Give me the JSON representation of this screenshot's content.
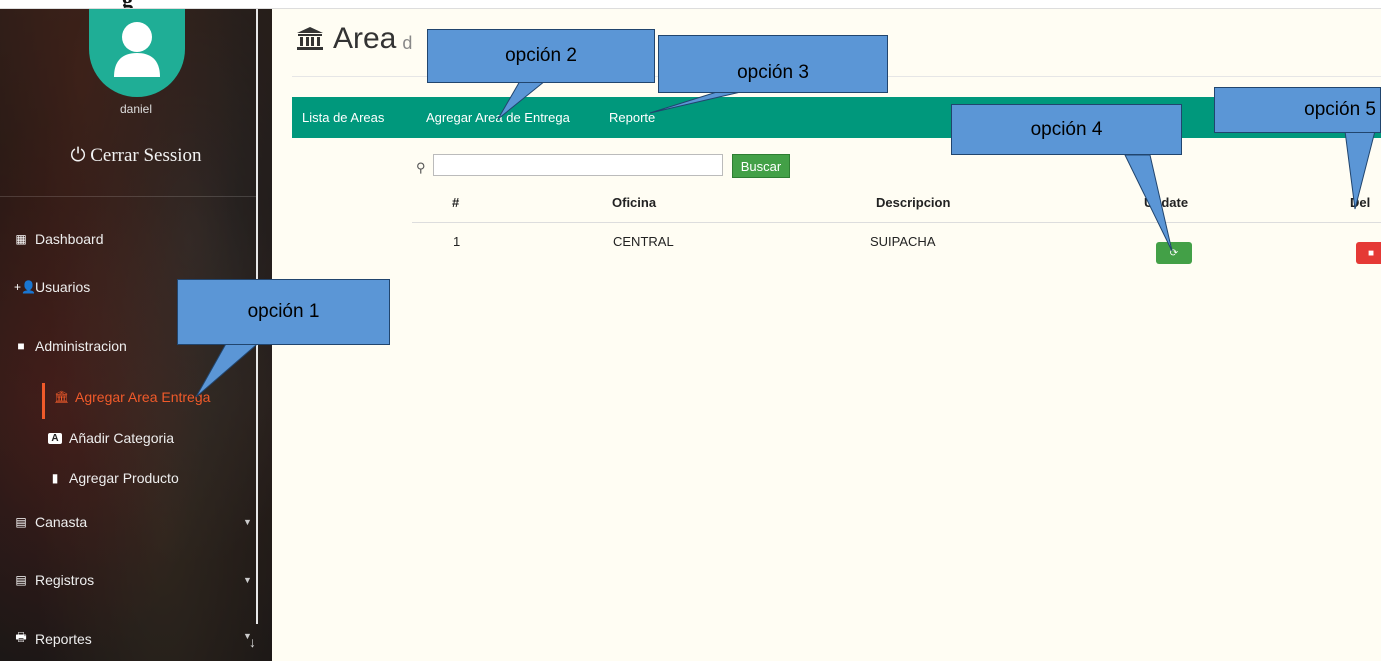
{
  "doc": {
    "heading": "g"
  },
  "sidebar": {
    "username": "daniel",
    "logout_label": "Cerrar Session",
    "items": [
      {
        "label": "Dashboard",
        "icon": "dashboard-icon"
      },
      {
        "label": "Usuarios",
        "icon": "add-user-icon"
      },
      {
        "label": "Administracion",
        "icon": "briefcase-icon"
      },
      {
        "label": "Agregar Area Entrega",
        "icon": "institution-icon",
        "active": true
      },
      {
        "label": "Añadir Categoria",
        "icon": "letter-a-icon"
      },
      {
        "label": "Agregar Producto",
        "icon": "book-icon"
      },
      {
        "label": "Canasta",
        "icon": "list-icon"
      },
      {
        "label": "Registros",
        "icon": "list-icon"
      },
      {
        "label": "Reportes",
        "icon": "print-icon"
      }
    ]
  },
  "main": {
    "title": "Area",
    "title_suffix": "d",
    "tabs": [
      "Lista de Areas",
      "Agregar Area de Entrega",
      "Reporte"
    ],
    "search": {
      "placeholder": "",
      "button_label": "Buscar"
    },
    "table": {
      "columns": [
        "#",
        "Oficina",
        "Descripcion",
        "Update",
        "Del"
      ],
      "rows": [
        {
          "num": "1",
          "oficina": "CENTRAL",
          "descripcion": "SUIPACHA"
        }
      ]
    }
  },
  "callouts": [
    "opción 1",
    "opción 2",
    "opción 3",
    "opción 4",
    "opción 5"
  ],
  "colors": {
    "accent": "#00987c",
    "active": "#f05a2a",
    "callout": "#5b96d6",
    "update": "#43a047",
    "delete": "#e53935"
  }
}
